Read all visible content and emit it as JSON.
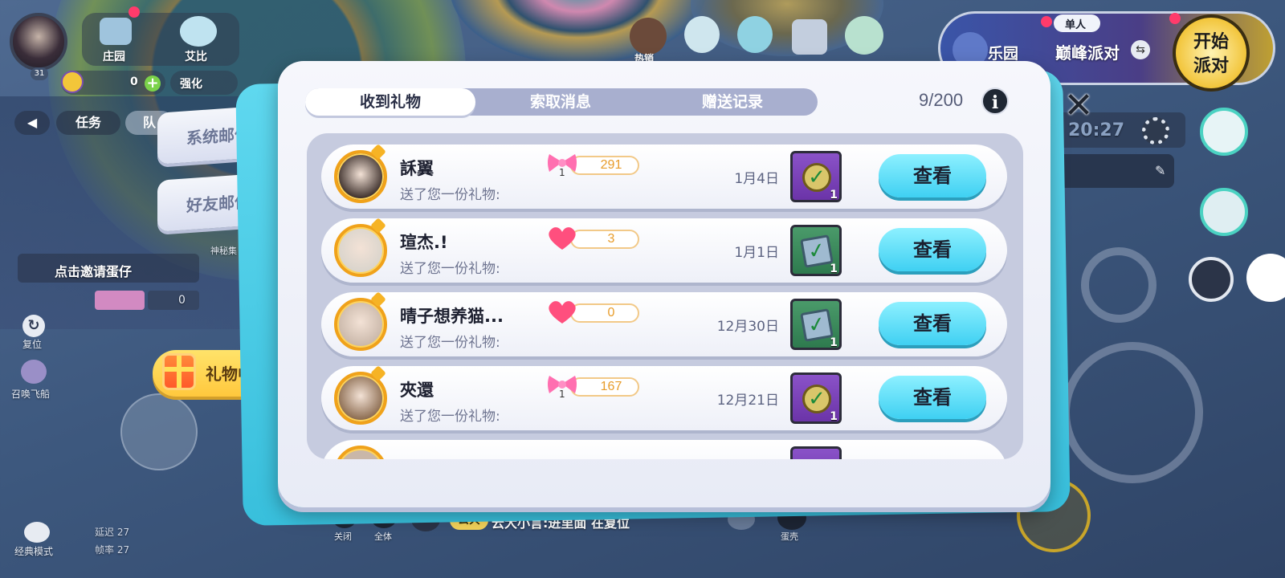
{
  "hud": {
    "player_level": "31",
    "nav_manor": "庄园",
    "nav_aibi": "艾比",
    "coins": "0",
    "enhance_label": "强化",
    "task_label": "任务",
    "team_label": "队",
    "invite_label": "点击邀请蛋仔",
    "counter_value": "0",
    "mystery_label": "神秘集",
    "reset_label": "复位",
    "summon_label": "召唤飞船",
    "classic_mode_label": "经典模式",
    "latency_label": "延迟 27",
    "fps_label": "帧率 27",
    "shop_hot_label": "热销",
    "park_label": "乐园",
    "single_label": "单人",
    "peak_party_label": "巅峰派对",
    "start_party_label": "开始派对",
    "time_label": "20:27",
    "chat_close_label": "关闭",
    "chat_all_label": "全体",
    "chat_channel": "公共",
    "chat_message": "云大小言:进里面 在复位",
    "egg_shell_label": "蛋壳"
  },
  "side_tabs": {
    "system_mail": "系统邮件",
    "friend_mail": "好友邮件",
    "gift_center": "礼物中心"
  },
  "modal": {
    "tabs": [
      "收到礼物",
      "索取消息",
      "赠送记录"
    ],
    "active_tab": 0,
    "counter": "9/200",
    "info_icon": "i",
    "close_icon": "✕",
    "rows": [
      {
        "name": "訸翼",
        "subtitle": "送了您一份礼物:",
        "gift_type": "bow",
        "gift_qty": "1",
        "gift_value": "291",
        "date": "1月4日",
        "item_type": "badge",
        "item_color": "purple",
        "item_count": "1",
        "button": "查看",
        "avatar_color": "#3b2e2a"
      },
      {
        "name": "瑄杰.!",
        "subtitle": "送了您一份礼物:",
        "gift_type": "heart",
        "gift_qty": "",
        "gift_value": "3",
        "date": "1月1日",
        "item_type": "ticket",
        "item_color": "green",
        "item_count": "1",
        "button": "查看",
        "avatar_color": "#d9d4cc"
      },
      {
        "name": "晴子想养猫...",
        "subtitle": "送了您一份礼物:",
        "gift_type": "heart",
        "gift_qty": "",
        "gift_value": "0",
        "date": "12月30日",
        "item_type": "ticket",
        "item_color": "green",
        "item_count": "1",
        "button": "查看",
        "avatar_color": "#c9b7a9"
      },
      {
        "name": "夾還",
        "subtitle": "送了您一份礼物:",
        "gift_type": "bow",
        "gift_qty": "1",
        "gift_value": "167",
        "date": "12月21日",
        "item_type": "badge",
        "item_color": "purple",
        "item_count": "1",
        "button": "查看",
        "avatar_color": "#8a6a4e"
      }
    ]
  },
  "colors": {
    "accent_cyan": "#3fd0f2",
    "gift_bar_text": "#e89c2a",
    "heart": "#ff4f7e",
    "bow": "#ff6fb0"
  }
}
